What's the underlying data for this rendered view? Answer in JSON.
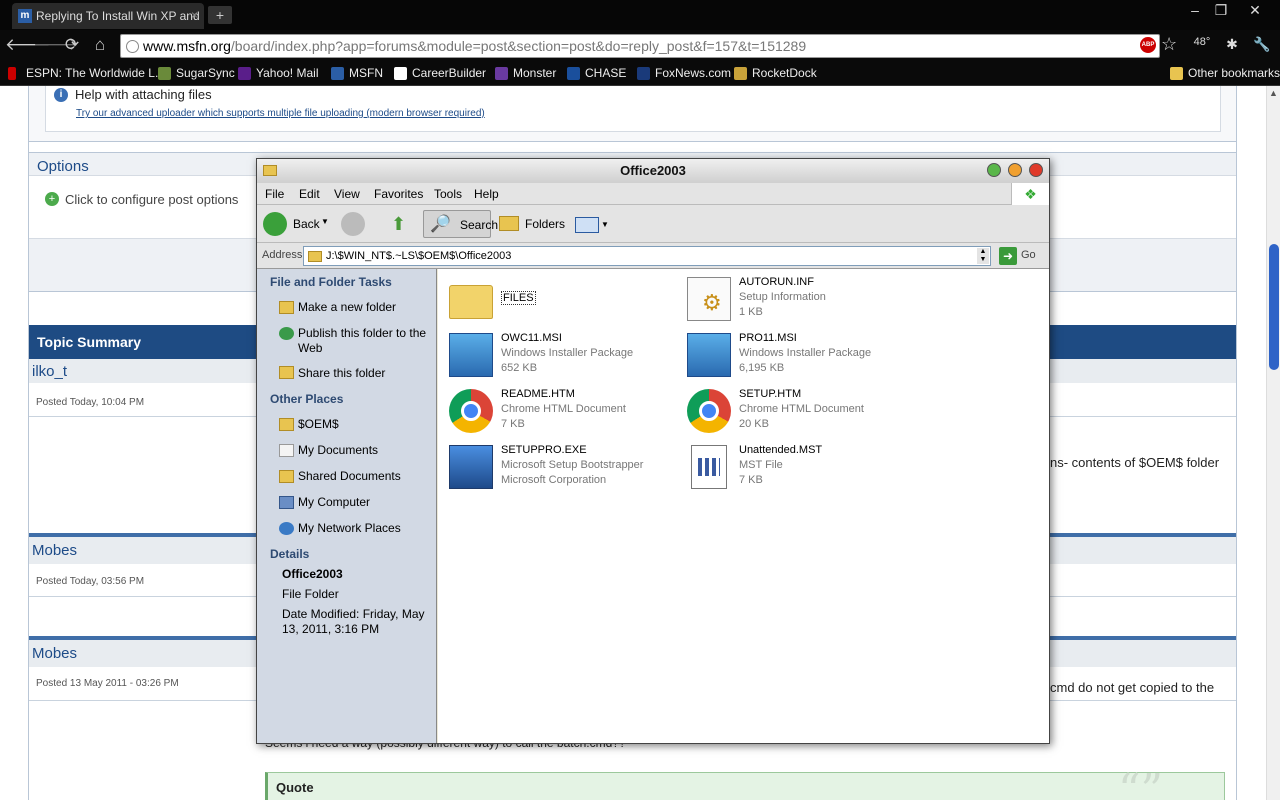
{
  "browser": {
    "tab_title": "Replying To Install Win XP and",
    "tab_close": "×",
    "new_tab": "+",
    "window_controls": [
      "–",
      "❐",
      "✕"
    ],
    "url_host": "www.msfn.org",
    "url_path": "/board/index.php?app=forums&module=post&section=post&do=reply_post&f=157&t=151289",
    "abp_label": "ABP",
    "weather": "48°",
    "bookmarks": [
      "ESPN: The Worldwide L...",
      "SugarSync",
      "Yahoo! Mail",
      "MSFN",
      "CareerBuilder",
      "Monster",
      "CHASE",
      "FoxNews.com",
      "RocketDock"
    ],
    "other_bookmarks": "Other bookmarks"
  },
  "forum": {
    "help_title": "Help with attaching files",
    "help_link": "Try our advanced uploader which supports multiple file uploading (modern browser required)",
    "options_title": "Options",
    "options_item": "Click to configure post options",
    "topic_summary": "Topic Summary",
    "posts": [
      {
        "user": "ilko_t",
        "posted": "Posted Today, 10:04 PM",
        "text": "ns- contents of $OEM$ folder"
      },
      {
        "user": "Mobes",
        "posted": "Posted Today, 03:56 PM"
      },
      {
        "user": "Mobes",
        "posted": "Posted 13 May 2011 - 03:26 PM",
        "text": "cmd do not get copied to the"
      }
    ],
    "partial_text": "Seems i need a way (possibly different way) to call the batch.cmd??",
    "quote_label": "Quote",
    "quote_mark": "“”"
  },
  "explorer": {
    "title": "Office2003",
    "menu": [
      "File",
      "Edit",
      "View",
      "Favorites",
      "Tools",
      "Help"
    ],
    "toolbar": {
      "back": "Back",
      "search": "Search",
      "folders": "Folders"
    },
    "address_label": "Address",
    "address_value": "J:\\$WIN_NT$.~LS\\$OEM$\\Office2003",
    "go_label": "Go",
    "tasks_title": "File and Folder Tasks",
    "tasks": [
      "Make a new folder",
      "Publish this folder to the Web",
      "Share this folder"
    ],
    "places_title": "Other Places",
    "places": [
      "$OEM$",
      "My Documents",
      "Shared Documents",
      "My Computer",
      "My Network Places"
    ],
    "details_title": "Details",
    "details_name": "Office2003",
    "details_type": "File Folder",
    "details_modified": "Date Modified: Friday, May 13, 2011, 3:16 PM",
    "files": [
      {
        "name": "FILES",
        "type": "",
        "size": "",
        "icon": "folder-icon"
      },
      {
        "name": "AUTORUN.INF",
        "type": "Setup Information",
        "size": "1 KB",
        "icon": "setup-info-icon"
      },
      {
        "name": "OWC11.MSI",
        "type": "Windows Installer Package",
        "size": "652 KB",
        "icon": "installer-icon"
      },
      {
        "name": "PRO11.MSI",
        "type": "Windows Installer Package",
        "size": "6,195 KB",
        "icon": "installer-icon"
      },
      {
        "name": "README.HTM",
        "type": "Chrome HTML Document",
        "size": "7 KB",
        "icon": "chrome-icon"
      },
      {
        "name": "SETUP.HTM",
        "type": "Chrome HTML Document",
        "size": "20 KB",
        "icon": "chrome-icon"
      },
      {
        "name": "SETUPPRO.EXE",
        "type": "Microsoft Setup Bootstrapper",
        "size": "Microsoft Corporation",
        "icon": "setup-exe-icon"
      },
      {
        "name": "Unattended.MST",
        "type": "MST File",
        "size": "7 KB",
        "icon": "mst-file-icon"
      }
    ]
  }
}
